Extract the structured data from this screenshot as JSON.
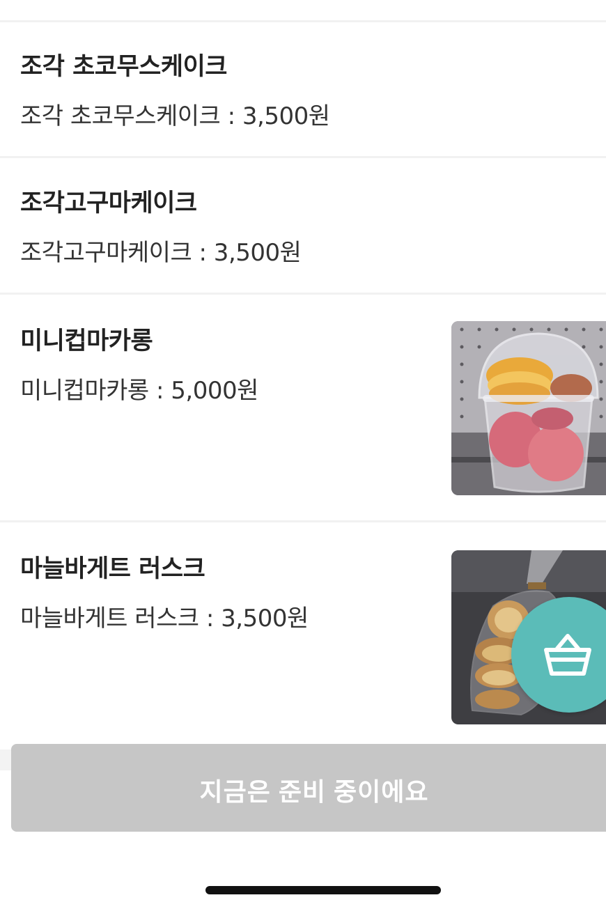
{
  "menu": {
    "items": [
      {
        "name": "조각 초코무스케이크",
        "desc": "조각 초코무스케이크 : 3,500원",
        "has_image": false
      },
      {
        "name": "조각고구마케이크",
        "desc": "조각고구마케이크 : 3,500원",
        "has_image": false
      },
      {
        "name": "미니컵마카롱",
        "desc": "미니컵마카롱 : 5,000원",
        "has_image": true,
        "image": "macaron-cup-photo"
      },
      {
        "name": "마늘바게트 러스크",
        "desc": "마늘바게트 러스크 : 3,500원",
        "has_image": true,
        "image": "garlic-rusk-bag-photo"
      }
    ]
  },
  "cart_fab": {
    "icon": "basket-icon",
    "color": "#5bbcb8"
  },
  "status_button": {
    "label": "지금은 준비 중이에요",
    "color": "#c6c6c6"
  }
}
